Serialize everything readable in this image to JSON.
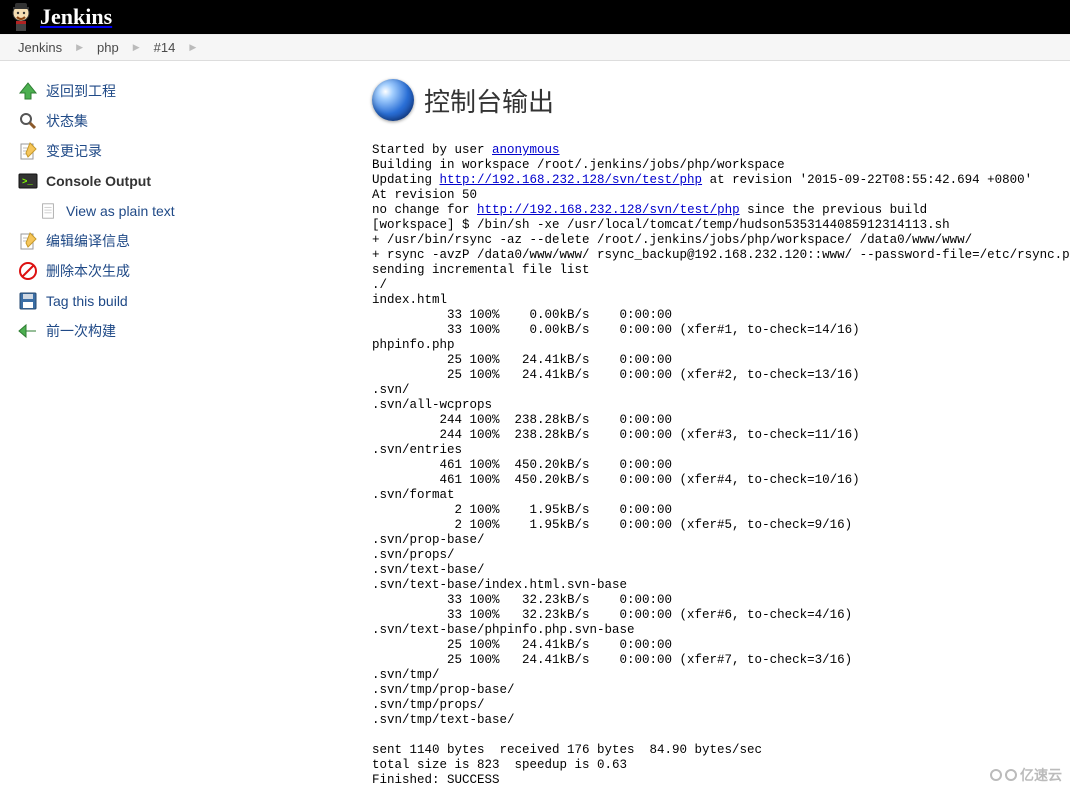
{
  "header": {
    "brand": "Jenkins"
  },
  "breadcrumbs": [
    "Jenkins",
    "php",
    "#14"
  ],
  "sidebar": {
    "items": [
      {
        "label": "返回到工程"
      },
      {
        "label": "状态集"
      },
      {
        "label": "变更记录"
      },
      {
        "label": "Console Output"
      },
      {
        "label": "View as plain text"
      },
      {
        "label": "编辑编译信息"
      },
      {
        "label": "删除本次生成"
      },
      {
        "label": "Tag this build"
      },
      {
        "label": "前一次构建"
      }
    ]
  },
  "page": {
    "title": "控制台输出"
  },
  "console": {
    "start_prefix": "Started by user ",
    "user": "anonymous",
    "line_workspace": "Building in workspace /root/.jenkins/jobs/php/workspace",
    "update_prefix": "Updating ",
    "svn_url": "http://192.168.232.128/svn/test/php",
    "update_suffix": " at revision '2015-09-22T08:55:42.694 +0800'",
    "at_revision": "At revision 50",
    "nochange_prefix": "no change for ",
    "nochange_suffix": " since the previous build",
    "rest": "[workspace] $ /bin/sh -xe /usr/local/tomcat/temp/hudson5353144085912314113.sh\n+ /usr/bin/rsync -az --delete /root/.jenkins/jobs/php/workspace/ /data0/www/www/\n+ rsync -avzP /data0/www/www/ rsync_backup@192.168.232.120::www/ --password-file=/etc/rsync.password\nsending incremental file list\n./\nindex.html\n          33 100%    0.00kB/s    0:00:00\n          33 100%    0.00kB/s    0:00:00 (xfer#1, to-check=14/16)\nphpinfo.php\n          25 100%   24.41kB/s    0:00:00\n          25 100%   24.41kB/s    0:00:00 (xfer#2, to-check=13/16)\n.svn/\n.svn/all-wcprops\n         244 100%  238.28kB/s    0:00:00\n         244 100%  238.28kB/s    0:00:00 (xfer#3, to-check=11/16)\n.svn/entries\n         461 100%  450.20kB/s    0:00:00\n         461 100%  450.20kB/s    0:00:00 (xfer#4, to-check=10/16)\n.svn/format\n           2 100%    1.95kB/s    0:00:00\n           2 100%    1.95kB/s    0:00:00 (xfer#5, to-check=9/16)\n.svn/prop-base/\n.svn/props/\n.svn/text-base/\n.svn/text-base/index.html.svn-base\n          33 100%   32.23kB/s    0:00:00\n          33 100%   32.23kB/s    0:00:00 (xfer#6, to-check=4/16)\n.svn/text-base/phpinfo.php.svn-base\n          25 100%   24.41kB/s    0:00:00\n          25 100%   24.41kB/s    0:00:00 (xfer#7, to-check=3/16)\n.svn/tmp/\n.svn/tmp/prop-base/\n.svn/tmp/props/\n.svn/tmp/text-base/\n\nsent 1140 bytes  received 176 bytes  84.90 bytes/sec\ntotal size is 823  speedup is 0.63\nFinished: SUCCESS"
  },
  "watermark": "亿速云"
}
